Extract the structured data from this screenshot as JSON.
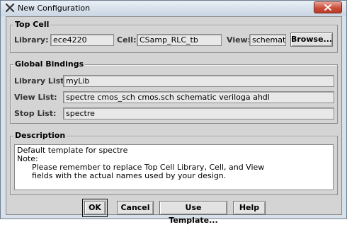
{
  "window": {
    "title": "New Configuration"
  },
  "top_cell": {
    "group_title": "Top Cell",
    "library_label": "Library:",
    "library_value": "ece4220",
    "cell_label": "Cell:",
    "cell_value": "CSamp_RLC_tb",
    "view_label": "View:",
    "view_value": "schematic",
    "browse_label": "Browse..."
  },
  "global_bindings": {
    "group_title": "Global Bindings",
    "library_list_label": "Library List:",
    "library_list_value": "myLib",
    "view_list_label": "View List:",
    "view_list_value": "spectre cmos_sch cmos.sch schematic veriloga ahdl",
    "stop_list_label": "Stop List:",
    "stop_list_value": "spectre"
  },
  "description": {
    "group_title": "Description",
    "text": "Default template for spectre\nNote:\n      Please remember to replace Top Cell Library, Cell, and View\n      fields with the actual names used by your design."
  },
  "buttons": {
    "ok": "OK",
    "cancel": "Cancel",
    "use_template": "Use Template...",
    "help": "Help"
  }
}
